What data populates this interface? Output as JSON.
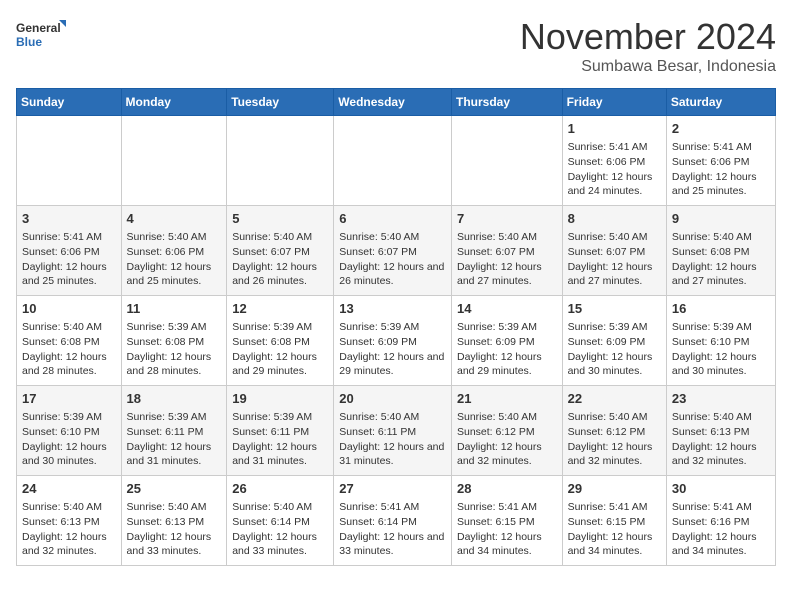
{
  "header": {
    "logo_line1": "General",
    "logo_line2": "Blue",
    "month": "November 2024",
    "location": "Sumbawa Besar, Indonesia"
  },
  "days_of_week": [
    "Sunday",
    "Monday",
    "Tuesday",
    "Wednesday",
    "Thursday",
    "Friday",
    "Saturday"
  ],
  "weeks": [
    [
      {
        "day": "",
        "info": ""
      },
      {
        "day": "",
        "info": ""
      },
      {
        "day": "",
        "info": ""
      },
      {
        "day": "",
        "info": ""
      },
      {
        "day": "",
        "info": ""
      },
      {
        "day": "1",
        "info": "Sunrise: 5:41 AM\nSunset: 6:06 PM\nDaylight: 12 hours and 24 minutes."
      },
      {
        "day": "2",
        "info": "Sunrise: 5:41 AM\nSunset: 6:06 PM\nDaylight: 12 hours and 25 minutes."
      }
    ],
    [
      {
        "day": "3",
        "info": "Sunrise: 5:41 AM\nSunset: 6:06 PM\nDaylight: 12 hours and 25 minutes."
      },
      {
        "day": "4",
        "info": "Sunrise: 5:40 AM\nSunset: 6:06 PM\nDaylight: 12 hours and 25 minutes."
      },
      {
        "day": "5",
        "info": "Sunrise: 5:40 AM\nSunset: 6:07 PM\nDaylight: 12 hours and 26 minutes."
      },
      {
        "day": "6",
        "info": "Sunrise: 5:40 AM\nSunset: 6:07 PM\nDaylight: 12 hours and 26 minutes."
      },
      {
        "day": "7",
        "info": "Sunrise: 5:40 AM\nSunset: 6:07 PM\nDaylight: 12 hours and 27 minutes."
      },
      {
        "day": "8",
        "info": "Sunrise: 5:40 AM\nSunset: 6:07 PM\nDaylight: 12 hours and 27 minutes."
      },
      {
        "day": "9",
        "info": "Sunrise: 5:40 AM\nSunset: 6:08 PM\nDaylight: 12 hours and 27 minutes."
      }
    ],
    [
      {
        "day": "10",
        "info": "Sunrise: 5:40 AM\nSunset: 6:08 PM\nDaylight: 12 hours and 28 minutes."
      },
      {
        "day": "11",
        "info": "Sunrise: 5:39 AM\nSunset: 6:08 PM\nDaylight: 12 hours and 28 minutes."
      },
      {
        "day": "12",
        "info": "Sunrise: 5:39 AM\nSunset: 6:08 PM\nDaylight: 12 hours and 29 minutes."
      },
      {
        "day": "13",
        "info": "Sunrise: 5:39 AM\nSunset: 6:09 PM\nDaylight: 12 hours and 29 minutes."
      },
      {
        "day": "14",
        "info": "Sunrise: 5:39 AM\nSunset: 6:09 PM\nDaylight: 12 hours and 29 minutes."
      },
      {
        "day": "15",
        "info": "Sunrise: 5:39 AM\nSunset: 6:09 PM\nDaylight: 12 hours and 30 minutes."
      },
      {
        "day": "16",
        "info": "Sunrise: 5:39 AM\nSunset: 6:10 PM\nDaylight: 12 hours and 30 minutes."
      }
    ],
    [
      {
        "day": "17",
        "info": "Sunrise: 5:39 AM\nSunset: 6:10 PM\nDaylight: 12 hours and 30 minutes."
      },
      {
        "day": "18",
        "info": "Sunrise: 5:39 AM\nSunset: 6:11 PM\nDaylight: 12 hours and 31 minutes."
      },
      {
        "day": "19",
        "info": "Sunrise: 5:39 AM\nSunset: 6:11 PM\nDaylight: 12 hours and 31 minutes."
      },
      {
        "day": "20",
        "info": "Sunrise: 5:40 AM\nSunset: 6:11 PM\nDaylight: 12 hours and 31 minutes."
      },
      {
        "day": "21",
        "info": "Sunrise: 5:40 AM\nSunset: 6:12 PM\nDaylight: 12 hours and 32 minutes."
      },
      {
        "day": "22",
        "info": "Sunrise: 5:40 AM\nSunset: 6:12 PM\nDaylight: 12 hours and 32 minutes."
      },
      {
        "day": "23",
        "info": "Sunrise: 5:40 AM\nSunset: 6:13 PM\nDaylight: 12 hours and 32 minutes."
      }
    ],
    [
      {
        "day": "24",
        "info": "Sunrise: 5:40 AM\nSunset: 6:13 PM\nDaylight: 12 hours and 32 minutes."
      },
      {
        "day": "25",
        "info": "Sunrise: 5:40 AM\nSunset: 6:13 PM\nDaylight: 12 hours and 33 minutes."
      },
      {
        "day": "26",
        "info": "Sunrise: 5:40 AM\nSunset: 6:14 PM\nDaylight: 12 hours and 33 minutes."
      },
      {
        "day": "27",
        "info": "Sunrise: 5:41 AM\nSunset: 6:14 PM\nDaylight: 12 hours and 33 minutes."
      },
      {
        "day": "28",
        "info": "Sunrise: 5:41 AM\nSunset: 6:15 PM\nDaylight: 12 hours and 34 minutes."
      },
      {
        "day": "29",
        "info": "Sunrise: 5:41 AM\nSunset: 6:15 PM\nDaylight: 12 hours and 34 minutes."
      },
      {
        "day": "30",
        "info": "Sunrise: 5:41 AM\nSunset: 6:16 PM\nDaylight: 12 hours and 34 minutes."
      }
    ]
  ]
}
